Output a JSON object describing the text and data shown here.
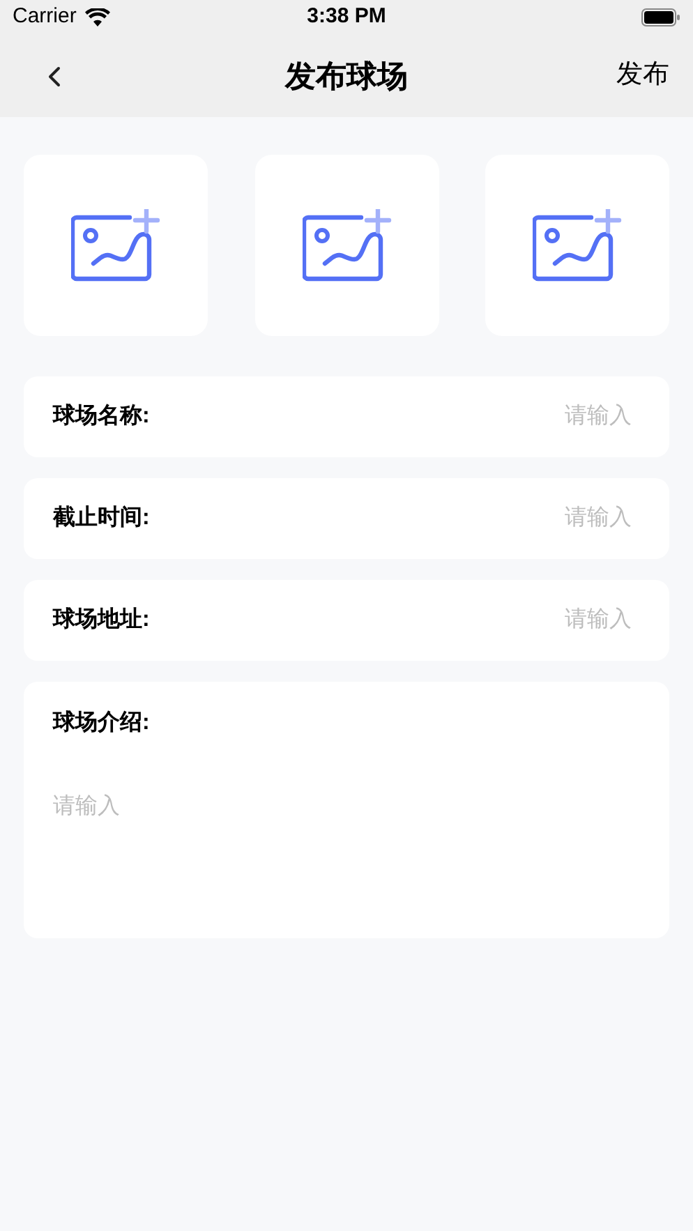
{
  "status_bar": {
    "carrier": "Carrier",
    "time": "3:38 PM"
  },
  "nav": {
    "title": "发布球场",
    "action": "发布"
  },
  "upload_slots": [
    {
      "kind": "add_image"
    },
    {
      "kind": "add_image"
    },
    {
      "kind": "add_image"
    }
  ],
  "fields": [
    {
      "kind": "line",
      "label": "球场名称:",
      "placeholder": "请输入"
    },
    {
      "kind": "line",
      "label": "截止时间:",
      "placeholder": "请输入"
    },
    {
      "kind": "line",
      "label": "球场地址:",
      "placeholder": "请输入"
    },
    {
      "kind": "multiline",
      "label": "球场介绍:",
      "placeholder": "请输入"
    }
  ]
}
